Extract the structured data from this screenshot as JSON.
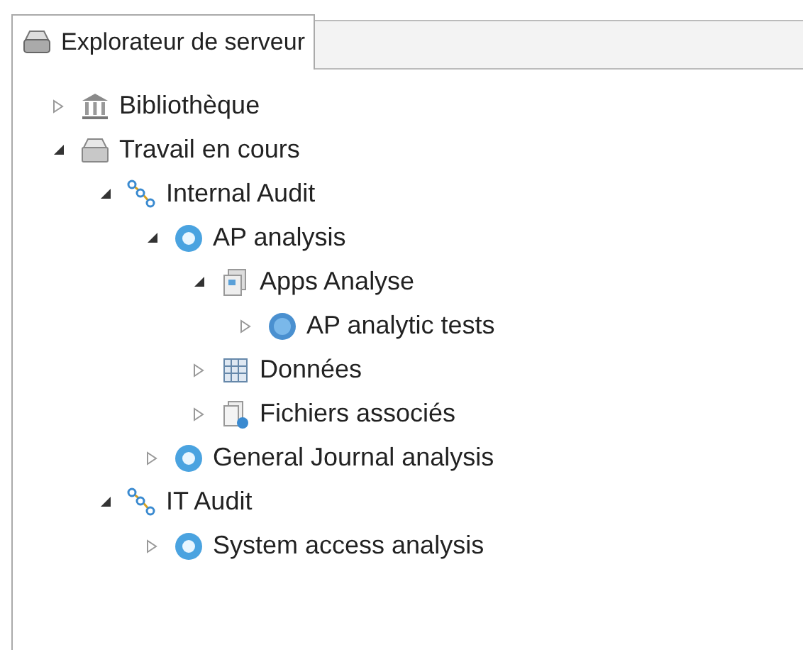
{
  "tab": {
    "title": "Explorateur de serveur",
    "selected": true
  },
  "tree": [
    {
      "label": "Bibliothèque",
      "kind": "library",
      "expanded": false
    },
    {
      "label": "Travail en cours",
      "kind": "workspace",
      "expanded": true,
      "children": [
        {
          "label": "Internal Audit",
          "kind": "project",
          "expanded": true,
          "children": [
            {
              "label": "AP analysis",
              "kind": "analysis",
              "expanded": true,
              "children": [
                {
                  "label": "Apps Analyse",
                  "kind": "app",
                  "expanded": true,
                  "children": [
                    {
                      "label": "AP analytic tests",
                      "kind": "script",
                      "expanded": false
                    }
                  ]
                },
                {
                  "label": "Données",
                  "kind": "data",
                  "expanded": false
                },
                {
                  "label": "Fichiers associés",
                  "kind": "files",
                  "expanded": false
                }
              ]
            },
            {
              "label": "General Journal analysis",
              "kind": "analysis",
              "expanded": false
            }
          ]
        },
        {
          "label": "IT Audit",
          "kind": "project",
          "expanded": true,
          "children": [
            {
              "label": "System access analysis",
              "kind": "analysis",
              "expanded": false
            }
          ]
        }
      ]
    }
  ]
}
